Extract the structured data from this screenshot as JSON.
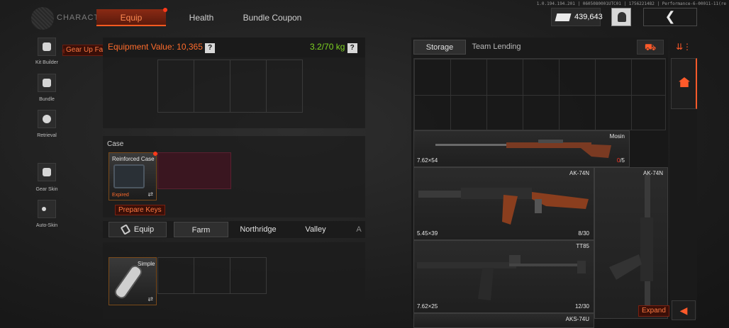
{
  "build_info": "1.0.194.194.201 | 0605080001UTC01 | 1756221482 | Performance-6-00011-11(re",
  "header": {
    "section": "CHARACTER",
    "tabs": [
      "Equip",
      "Health",
      "Bundle Coupon"
    ],
    "currency_amount": "439,643",
    "back_symbol": "❮"
  },
  "left_rail": {
    "items": [
      "Kit Builder",
      "Bundle",
      "Retrieval",
      "Gear Skin",
      "Auto-Skin"
    ],
    "tooltip": "Gear Up Fast"
  },
  "equip_panel": {
    "equipment_value": "Equipment Value: 10,365",
    "weight": "3.2/70 kg",
    "help": "?"
  },
  "case": {
    "label": "Case",
    "item_name": "Reinforced Case",
    "status": "Expired",
    "prepare_keys": "Prepare Keys"
  },
  "locations": {
    "equip_label": "Equip",
    "tabs": [
      "Farm",
      "Northridge",
      "Valley",
      "A"
    ]
  },
  "key_item": {
    "name": "Simple"
  },
  "storage": {
    "tabs": [
      "Storage",
      "Team Lending"
    ],
    "weapons": [
      {
        "name": "Mosin",
        "ammo": "7.62×54",
        "count_current": "0",
        "count_total": "/5"
      },
      {
        "name": "AK-74N",
        "ammo": "5.45×39",
        "count": "8/30"
      },
      {
        "name": "AK-74N",
        "ammo": "",
        "count": ""
      },
      {
        "name": "TT85",
        "ammo": "7.62×25",
        "count": "12/30"
      },
      {
        "name": "AKS-74U",
        "ammo": "",
        "count": ""
      }
    ],
    "expand": "Expand"
  },
  "colors": {
    "accent": "#ff5a2a",
    "weight_ok": "#7ed321",
    "panel": "#1a1a1a"
  }
}
